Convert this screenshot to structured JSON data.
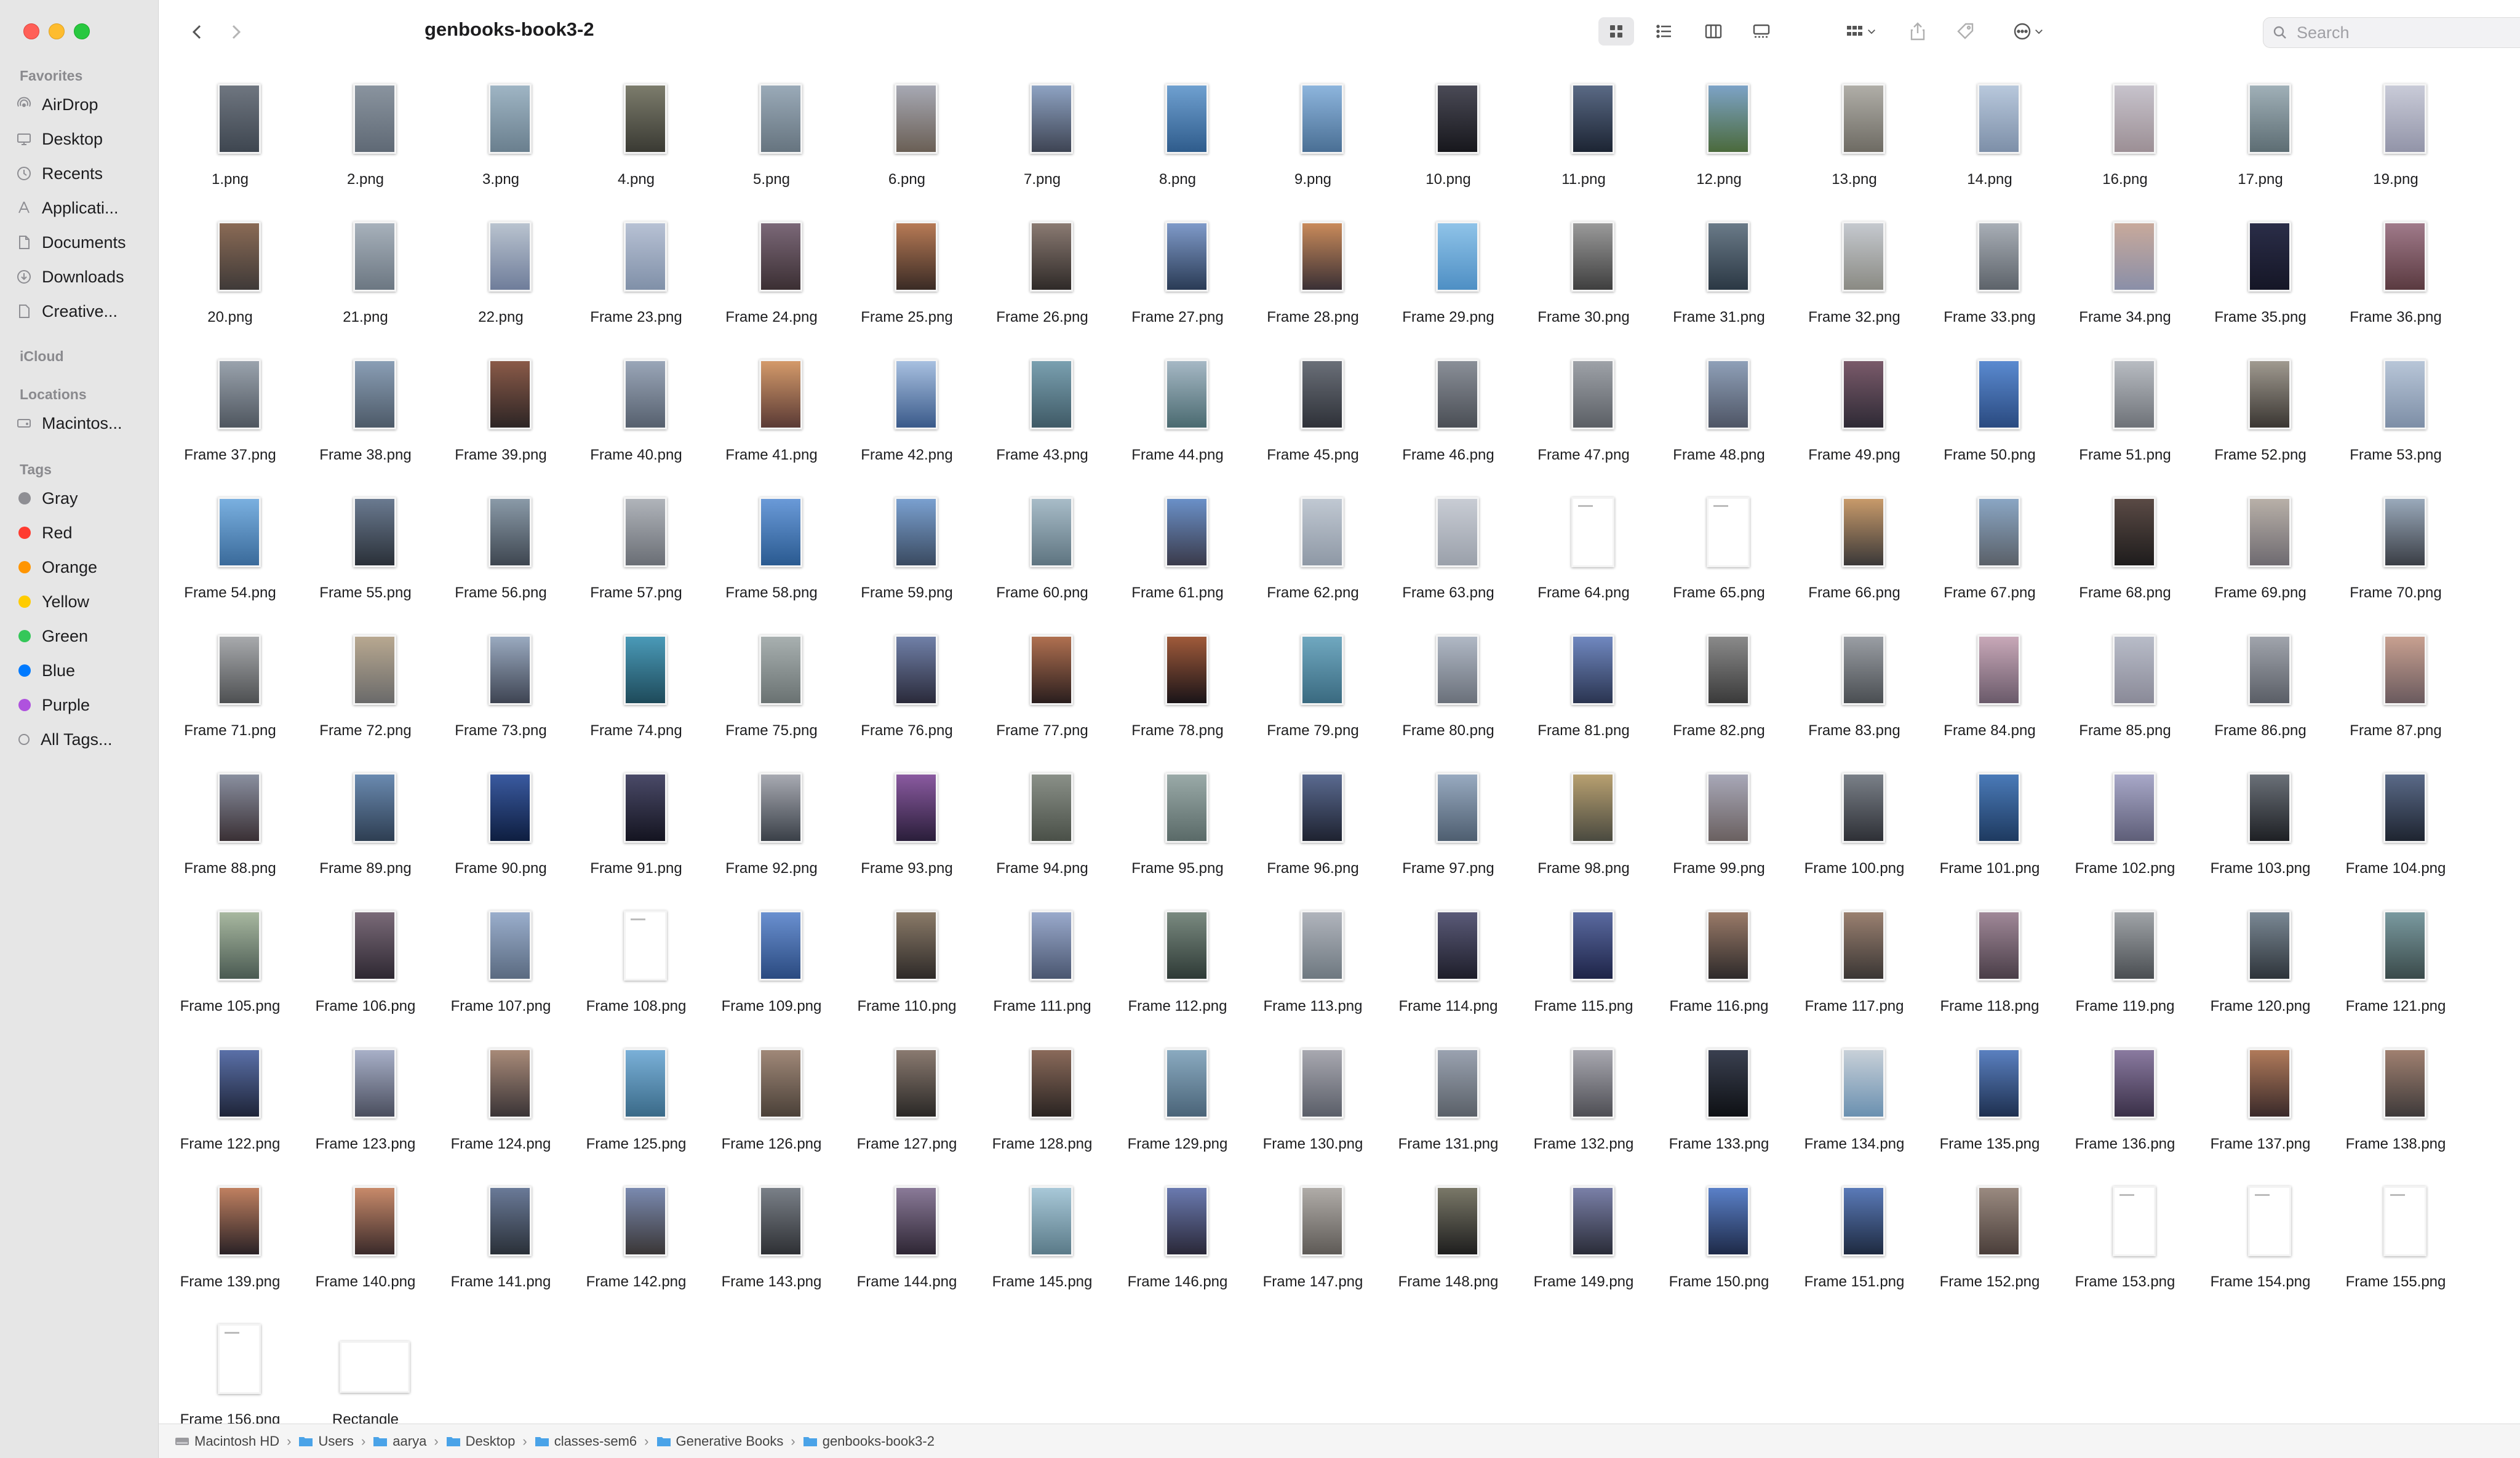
{
  "window": {
    "title": "genbooks-book3-2"
  },
  "toolbar": {
    "search_placeholder": "Search"
  },
  "sidebar": {
    "favorites_header": "Favorites",
    "favorites": [
      {
        "label": "AirDrop",
        "icon": "airdrop-icon"
      },
      {
        "label": "Desktop",
        "icon": "desktop-icon"
      },
      {
        "label": "Recents",
        "icon": "clock-icon"
      },
      {
        "label": "Applicati...",
        "icon": "applications-icon"
      },
      {
        "label": "Documents",
        "icon": "document-icon"
      },
      {
        "label": "Downloads",
        "icon": "download-icon"
      },
      {
        "label": "Creative...",
        "icon": "file-icon"
      }
    ],
    "icloud_header": "iCloud",
    "locations_header": "Locations",
    "locations": [
      {
        "label": "Macintos...",
        "icon": "hard-drive-icon"
      }
    ],
    "tags_header": "Tags",
    "tags": [
      {
        "label": "Gray",
        "color": "#8e8e93"
      },
      {
        "label": "Red",
        "color": "#ff3b30"
      },
      {
        "label": "Orange",
        "color": "#ff9500"
      },
      {
        "label": "Yellow",
        "color": "#ffcc00"
      },
      {
        "label": "Green",
        "color": "#34c759"
      },
      {
        "label": "Blue",
        "color": "#007aff"
      },
      {
        "label": "Purple",
        "color": "#af52de"
      },
      {
        "label": "All Tags...",
        "color": ""
      }
    ]
  },
  "files": [
    {
      "name": "1.png",
      "colors": [
        "#6f7680",
        "#3e4650"
      ]
    },
    {
      "name": "2.png",
      "colors": [
        "#8a949f",
        "#5f6975"
      ]
    },
    {
      "name": "3.png",
      "colors": [
        "#9fb5c4",
        "#6a7f8e"
      ]
    },
    {
      "name": "4.png",
      "colors": [
        "#7c7c6c",
        "#3a3a33"
      ]
    },
    {
      "name": "5.png",
      "colors": [
        "#9aaab8",
        "#66747f"
      ]
    },
    {
      "name": "6.png",
      "colors": [
        "#a7a9b4",
        "#6a5f55"
      ]
    },
    {
      "name": "7.png",
      "colors": [
        "#8ea3c3",
        "#3e4453"
      ]
    },
    {
      "name": "8.png",
      "colors": [
        "#6fa0d0",
        "#2f5c8c"
      ]
    },
    {
      "name": "9.png",
      "colors": [
        "#8db5dd",
        "#4a6f94"
      ]
    },
    {
      "name": "10.png",
      "colors": [
        "#4a4a56",
        "#17171c"
      ]
    },
    {
      "name": "11.png",
      "colors": [
        "#5a6a85",
        "#1c2433"
      ]
    },
    {
      "name": "12.png",
      "colors": [
        "#7da3c7",
        "#4b6a3c"
      ]
    },
    {
      "name": "13.png",
      "colors": [
        "#b0aea8",
        "#6e6b63"
      ]
    },
    {
      "name": "14.png",
      "colors": [
        "#b8c8dc",
        "#7d8fa8"
      ]
    },
    {
      "name": "16.png",
      "colors": [
        "#c7c3cc",
        "#9c8f95"
      ]
    },
    {
      "name": "17.png",
      "colors": [
        "#a0b0b8",
        "#5d6d73"
      ]
    },
    {
      "name": "19.png",
      "colors": [
        "#c9cbd8",
        "#9294a8"
      ]
    },
    {
      "name": "20.png",
      "colors": [
        "#8a6a55",
        "#3f3a38"
      ]
    },
    {
      "name": "21.png",
      "colors": [
        "#a7b1bb",
        "#6c7782"
      ]
    },
    {
      "name": "22.png",
      "colors": [
        "#b9c3cf",
        "#6f7d9a"
      ]
    },
    {
      "name": "Frame 23.png",
      "colors": [
        "#b7c1d4",
        "#8090a8"
      ]
    },
    {
      "name": "Frame 24.png",
      "colors": [
        "#7b6878",
        "#3b2f33"
      ]
    },
    {
      "name": "Frame 25.png",
      "colors": [
        "#b77a55",
        "#3a2b25"
      ]
    },
    {
      "name": "Frame 26.png",
      "colors": [
        "#8a7a72",
        "#2f2a28"
      ]
    },
    {
      "name": "Frame 27.png",
      "colors": [
        "#7f9ac9",
        "#2a3b55"
      ]
    },
    {
      "name": "Frame 28.png",
      "colors": [
        "#c98a5a",
        "#3a3035"
      ]
    },
    {
      "name": "Frame 29.png",
      "colors": [
        "#8fc3e8",
        "#4e8fc4"
      ]
    },
    {
      "name": "Frame 30.png",
      "colors": [
        "#9a9a9a",
        "#3f3f3f"
      ]
    },
    {
      "name": "Frame 31.png",
      "colors": [
        "#6a7a88",
        "#2b3844"
      ]
    },
    {
      "name": "Frame 32.png",
      "colors": [
        "#c5c9cf",
        "#8a8a83"
      ]
    },
    {
      "name": "Frame 33.png",
      "colors": [
        "#a8aeb6",
        "#5d636a"
      ]
    },
    {
      "name": "Frame 34.png",
      "colors": [
        "#c8a99b",
        "#8a8fa8"
      ]
    },
    {
      "name": "Frame 35.png",
      "colors": [
        "#2a2d48",
        "#151626"
      ]
    },
    {
      "name": "Frame 36.png",
      "colors": [
        "#a07a8a",
        "#5a3a40"
      ]
    },
    {
      "name": "Frame 37.png",
      "colors": [
        "#9aa3ad",
        "#4f565f"
      ]
    },
    {
      "name": "Frame 38.png",
      "colors": [
        "#8a9eb5",
        "#4d5a68"
      ]
    },
    {
      "name": "Frame 39.png",
      "colors": [
        "#8a5a48",
        "#2d2525"
      ]
    },
    {
      "name": "Frame 40.png",
      "colors": [
        "#9aa6b8",
        "#56606e"
      ]
    },
    {
      "name": "Frame 41.png",
      "colors": [
        "#d49a6a",
        "#5a3a35"
      ]
    },
    {
      "name": "Frame 42.png",
      "colors": [
        "#a8c0e0",
        "#3a5a8a"
      ]
    },
    {
      "name": "Frame 43.png",
      "colors": [
        "#7aa0b0",
        "#3f5a66"
      ]
    },
    {
      "name": "Frame 44.png",
      "colors": [
        "#a6b8c5",
        "#4a6a70"
      ]
    },
    {
      "name": "Frame 45.png",
      "colors": [
        "#6a6f78",
        "#2e3138"
      ]
    },
    {
      "name": "Frame 46.png",
      "colors": [
        "#8a8f98",
        "#4a4e55"
      ]
    },
    {
      "name": "Frame 47.png",
      "colors": [
        "#9ea2a8",
        "#5b5f65"
      ]
    },
    {
      "name": "Frame 48.png",
      "colors": [
        "#8fa0b8",
        "#4e5565"
      ]
    },
    {
      "name": "Frame 49.png",
      "colors": [
        "#7a5a6a",
        "#2e2a35"
      ]
    },
    {
      "name": "Frame 50.png",
      "colors": [
        "#5a8ad0",
        "#2a4a80"
      ]
    },
    {
      "name": "Frame 51.png",
      "colors": [
        "#b8bcc2",
        "#6e7278"
      ]
    },
    {
      "name": "Frame 52.png",
      "colors": [
        "#a09a90",
        "#3a3632"
      ]
    },
    {
      "name": "Frame 53.png",
      "colors": [
        "#b8c6d8",
        "#7d8ea6"
      ]
    },
    {
      "name": "Frame 54.png",
      "colors": [
        "#7ab0e0",
        "#3a6a9a"
      ]
    },
    {
      "name": "Frame 55.png",
      "colors": [
        "#6a7a90",
        "#2a3038"
      ]
    },
    {
      "name": "Frame 56.png",
      "colors": [
        "#8a9aa8",
        "#3e4650"
      ]
    },
    {
      "name": "Frame 57.png",
      "colors": [
        "#b0b4ba",
        "#6a6e75"
      ]
    },
    {
      "name": "Frame 58.png",
      "colors": [
        "#6a9ad8",
        "#2a5a90"
      ]
    },
    {
      "name": "Frame 59.png",
      "colors": [
        "#7aa0d0",
        "#3a4a60"
      ]
    },
    {
      "name": "Frame 60.png",
      "colors": [
        "#a8bcc8",
        "#5e7480"
      ]
    },
    {
      "name": "Frame 61.png",
      "colors": [
        "#6a90c8",
        "#3a3a4a"
      ]
    },
    {
      "name": "Frame 62.png",
      "colors": [
        "#c0c8d2",
        "#8e98a5"
      ]
    },
    {
      "name": "Frame 63.png",
      "colors": [
        "#c8ccd4",
        "#9aa0aa"
      ]
    },
    {
      "name": "Frame 64.png",
      "colors": [],
      "doc": true
    },
    {
      "name": "Frame 65.png",
      "colors": [],
      "doc": true
    },
    {
      "name": "Frame 66.png",
      "colors": [
        "#c89a6a",
        "#3a3838"
      ]
    },
    {
      "name": "Frame 67.png",
      "colors": [
        "#8aa6c4",
        "#5a6068"
      ]
    },
    {
      "name": "Frame 68.png",
      "colors": [
        "#5a4a45",
        "#1e1c1c"
      ]
    },
    {
      "name": "Frame 69.png",
      "colors": [
        "#b8b0a8",
        "#6e6a70"
      ]
    },
    {
      "name": "Frame 70.png",
      "colors": [
        "#9aaabb",
        "#3a3e45"
      ]
    },
    {
      "name": "Frame 71.png",
      "colors": [
        "#a8aaad",
        "#4e5052"
      ]
    },
    {
      "name": "Frame 72.png",
      "colors": [
        "#b8a890",
        "#6a6a6a"
      ]
    },
    {
      "name": "Frame 73.png",
      "colors": [
        "#9aaac0",
        "#3e4452"
      ]
    },
    {
      "name": "Frame 74.png",
      "colors": [
        "#4a9ab8",
        "#1e4a5a"
      ]
    },
    {
      "name": "Frame 75.png",
      "colors": [
        "#a8b0b0",
        "#6a7272"
      ]
    },
    {
      "name": "Frame 76.png",
      "colors": [
        "#7080a8",
        "#2a2a3a"
      ]
    },
    {
      "name": "Frame 77.png",
      "colors": [
        "#b07050",
        "#2a1e1e"
      ]
    },
    {
      "name": "Frame 78.png",
      "colors": [
        "#a05a3a",
        "#1a1418"
      ]
    },
    {
      "name": "Frame 79.png",
      "colors": [
        "#70a8c0",
        "#3a6a80"
      ]
    },
    {
      "name": "Frame 80.png",
      "colors": [
        "#b0b8c5",
        "#6a707a"
      ]
    },
    {
      "name": "Frame 81.png",
      "colors": [
        "#7088c0",
        "#2a3450"
      ]
    },
    {
      "name": "Frame 82.png",
      "colors": [
        "#8a8a8a",
        "#3a3a3a"
      ]
    },
    {
      "name": "Frame 83.png",
      "colors": [
        "#9a9ea4",
        "#4a4e52"
      ]
    },
    {
      "name": "Frame 84.png",
      "colors": [
        "#c8a8b8",
        "#6a5a6a"
      ]
    },
    {
      "name": "Frame 85.png",
      "colors": [
        "#b8bcc8",
        "#8a8a98"
      ]
    },
    {
      "name": "Frame 86.png",
      "colors": [
        "#a0a4ac",
        "#5a5e66"
      ]
    },
    {
      "name": "Frame 87.png",
      "colors": [
        "#c8a090",
        "#6a5a5e"
      ]
    },
    {
      "name": "Frame 88.png",
      "colors": [
        "#8a90a0",
        "#3a3035"
      ]
    },
    {
      "name": "Frame 89.png",
      "colors": [
        "#6a8ab0",
        "#2e3e52"
      ]
    },
    {
      "name": "Frame 90.png",
      "colors": [
        "#3a5aa0",
        "#0e1e40"
      ]
    },
    {
      "name": "Frame 91.png",
      "colors": [
        "#4a4a68",
        "#141420"
      ]
    },
    {
      "name": "Frame 92.png",
      "colors": [
        "#a8aab2",
        "#3a4048"
      ]
    },
    {
      "name": "Frame 93.png",
      "colors": [
        "#8a5aa0",
        "#2a1e3a"
      ]
    },
    {
      "name": "Frame 94.png",
      "colors": [
        "#8a9088",
        "#4a5048"
      ]
    },
    {
      "name": "Frame 95.png",
      "colors": [
        "#9aaaa8",
        "#5a6a68"
      ]
    },
    {
      "name": "Frame 96.png",
      "colors": [
        "#5a6a90",
        "#1e2230"
      ]
    },
    {
      "name": "Frame 97.png",
      "colors": [
        "#98aac0",
        "#4e5e70"
      ]
    },
    {
      "name": "Frame 98.png",
      "colors": [
        "#b8a070",
        "#4a4a40"
      ]
    },
    {
      "name": "Frame 99.png",
      "colors": [
        "#a8a8b8",
        "#6a6060"
      ]
    },
    {
      "name": "Frame 100.png",
      "colors": [
        "#7a8088",
        "#2e3036"
      ]
    },
    {
      "name": "Frame 101.png",
      "colors": [
        "#4a7ab8",
        "#1e3a60"
      ]
    },
    {
      "name": "Frame 102.png",
      "colors": [
        "#a8a8c8",
        "#5e5e78"
      ]
    },
    {
      "name": "Frame 103.png",
      "colors": [
        "#6a7078",
        "#1e2024"
      ]
    },
    {
      "name": "Frame 104.png",
      "colors": [
        "#5a6a88",
        "#1e2430"
      ]
    },
    {
      "name": "Frame 105.png",
      "colors": [
        "#a8b8a0",
        "#4a5a52"
      ]
    },
    {
      "name": "Frame 106.png",
      "colors": [
        "#7a6a78",
        "#2e2832"
      ]
    },
    {
      "name": "Frame 107.png",
      "colors": [
        "#9aaecc",
        "#5a6a80"
      ]
    },
    {
      "name": "Frame 108.png",
      "colors": [],
      "doc": true
    },
    {
      "name": "Frame 109.png",
      "colors": [
        "#6a90d0",
        "#2a4a80"
      ]
    },
    {
      "name": "Frame 110.png",
      "colors": [
        "#8a7a68",
        "#2e2a28"
      ]
    },
    {
      "name": "Frame 111.png",
      "colors": [
        "#9aaacc",
        "#4a5670"
      ]
    },
    {
      "name": "Frame 112.png",
      "colors": [
        "#7a8a80",
        "#2e3a36"
      ]
    },
    {
      "name": "Frame 113.png",
      "colors": [
        "#b0b4bc",
        "#6e7880"
      ]
    },
    {
      "name": "Frame 114.png",
      "colors": [
        "#5a5a78",
        "#1e1e2a"
      ]
    },
    {
      "name": "Frame 115.png",
      "colors": [
        "#5a6aa0",
        "#1e2448"
      ]
    },
    {
      "name": "Frame 116.png",
      "colors": [
        "#9a7a68",
        "#2e2a2a"
      ]
    },
    {
      "name": "Frame 117.png",
      "colors": [
        "#9a8070",
        "#3a3634"
      ]
    },
    {
      "name": "Frame 118.png",
      "colors": [
        "#a08898",
        "#4a3e48"
      ]
    },
    {
      "name": "Frame 119.png",
      "colors": [
        "#a0a4a8",
        "#4a4e52"
      ]
    },
    {
      "name": "Frame 120.png",
      "colors": [
        "#7a8894",
        "#2e343a"
      ]
    },
    {
      "name": "Frame 121.png",
      "colors": [
        "#7a9aa0",
        "#3a4a4a"
      ]
    },
    {
      "name": "Frame 122.png",
      "colors": [
        "#5a70a8",
        "#1e2438"
      ]
    },
    {
      "name": "Frame 123.png",
      "colors": [
        "#a8b0c8",
        "#4a4e5e"
      ]
    },
    {
      "name": "Frame 124.png",
      "colors": [
        "#a88a78",
        "#3a3436"
      ]
    },
    {
      "name": "Frame 125.png",
      "colors": [
        "#7ab0d8",
        "#3a6a88"
      ]
    },
    {
      "name": "Frame 126.png",
      "colors": [
        "#a08878",
        "#4a4038"
      ]
    },
    {
      "name": "Frame 127.png",
      "colors": [
        "#8a7a70",
        "#2a2826"
      ]
    },
    {
      "name": "Frame 128.png",
      "colors": [
        "#8a6a5a",
        "#2a2422"
      ]
    },
    {
      "name": "Frame 129.png",
      "colors": [
        "#8aaac0",
        "#4a6478"
      ]
    },
    {
      "name": "Frame 130.png",
      "colors": [
        "#a8a8b0",
        "#5a5e68"
      ]
    },
    {
      "name": "Frame 131.png",
      "colors": [
        "#9aa2b0",
        "#5a6068"
      ]
    },
    {
      "name": "Frame 132.png",
      "colors": [
        "#a8a8b0",
        "#4e4e54"
      ]
    },
    {
      "name": "Frame 133.png",
      "colors": [
        "#3a4050",
        "#0e1014"
      ]
    },
    {
      "name": "Frame 134.png",
      "colors": [
        "#c8d0d8",
        "#6a90b0"
      ]
    },
    {
      "name": "Frame 135.png",
      "colors": [
        "#5a80c0",
        "#1e3050"
      ]
    },
    {
      "name": "Frame 136.png",
      "colors": [
        "#8a7aa0",
        "#3a3048"
      ]
    },
    {
      "name": "Frame 137.png",
      "colors": [
        "#b07a5a",
        "#3a2a2a"
      ]
    },
    {
      "name": "Frame 138.png",
      "colors": [
        "#a08070",
        "#3e3a3a"
      ]
    },
    {
      "name": "Frame 139.png",
      "colors": [
        "#c08060",
        "#2a2226"
      ]
    },
    {
      "name": "Frame 140.png",
      "colors": [
        "#c88a6a",
        "#3a2a2a"
      ]
    },
    {
      "name": "Frame 141.png",
      "colors": [
        "#6a7a98",
        "#2a3038"
      ]
    },
    {
      "name": "Frame 142.png",
      "colors": [
        "#7a8ab0",
        "#3a3636"
      ]
    },
    {
      "name": "Frame 143.png",
      "colors": [
        "#7a8088",
        "#2e3034"
      ]
    },
    {
      "name": "Frame 144.png",
      "colors": [
        "#8a7a98",
        "#2e2634"
      ]
    },
    {
      "name": "Frame 145.png",
      "colors": [
        "#a8c8d8",
        "#5a7a88"
      ]
    },
    {
      "name": "Frame 146.png",
      "colors": [
        "#6a7ab0",
        "#2a2838"
      ]
    },
    {
      "name": "Frame 147.png",
      "colors": [
        "#b0aca8",
        "#5e5a56"
      ]
    },
    {
      "name": "Frame 148.png",
      "colors": [
        "#7a7868",
        "#1e1e1e"
      ]
    },
    {
      "name": "Frame 149.png",
      "colors": [
        "#7a80a8",
        "#2a2c38"
      ]
    },
    {
      "name": "Frame 150.png",
      "colors": [
        "#5a80c8",
        "#1e2a48"
      ]
    },
    {
      "name": "Frame 151.png",
      "colors": [
        "#5a7ab8",
        "#1e2a40"
      ]
    },
    {
      "name": "Frame 152.png",
      "colors": [
        "#9a8a80",
        "#4a3e3a"
      ]
    },
    {
      "name": "Frame 153.png",
      "colors": [],
      "doc": true
    },
    {
      "name": "Frame 154.png",
      "colors": [],
      "doc": true
    },
    {
      "name": "Frame 155.png",
      "colors": [],
      "doc": true
    },
    {
      "name": "Frame 156.png",
      "colors": [],
      "doc": true
    },
    {
      "name": "Rectangle",
      "colors": [],
      "doc": true,
      "rect": true
    }
  ],
  "path": [
    {
      "label": "Macintosh HD",
      "icon": "hard-drive-icon"
    },
    {
      "label": "Users",
      "icon": "folder-icon"
    },
    {
      "label": "aarya",
      "icon": "folder-icon"
    },
    {
      "label": "Desktop",
      "icon": "folder-icon"
    },
    {
      "label": "classes-sem6",
      "icon": "folder-icon"
    },
    {
      "label": "Generative Books",
      "icon": "folder-icon"
    },
    {
      "label": "genbooks-book3-2",
      "icon": "folder-icon"
    }
  ],
  "colors": {
    "sidebar_bg": "#e6e6e6",
    "selection": "#d5d5d8",
    "folder_blue": "#4aa3e8"
  }
}
